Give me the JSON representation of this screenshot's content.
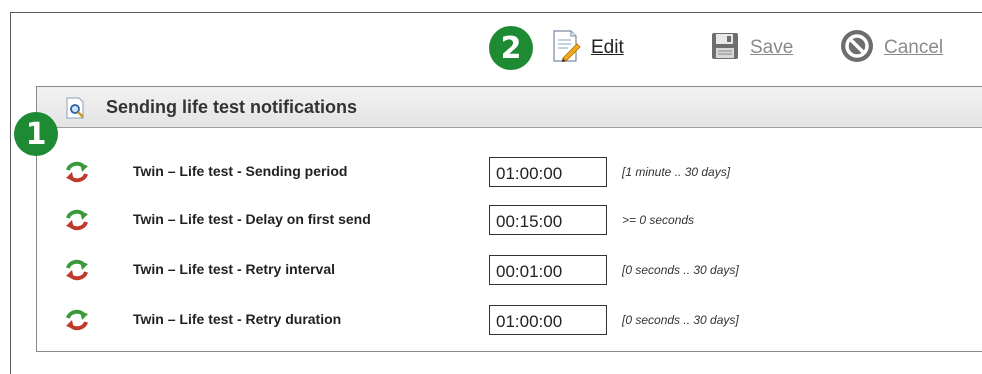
{
  "toolbar": {
    "badge": "2",
    "edit_label": "Edit",
    "save_label": "Save",
    "cancel_label": "Cancel"
  },
  "panel": {
    "badge": "1",
    "title": "Sending life test notifications",
    "rows": [
      {
        "label": "Twin – Life test - Sending period",
        "value": "01:00:00",
        "range": "[1 minute .. 30 days]"
      },
      {
        "label": "Twin – Life test - Delay on first send",
        "value": "00:15:00",
        "range": ">= 0 seconds"
      },
      {
        "label": "Twin – Life test - Retry interval",
        "value": "00:01:00",
        "range": "[0 seconds .. 30 days]"
      },
      {
        "label": "Twin – Life test - Retry duration",
        "value": "01:00:00",
        "range": "[0 seconds .. 30 days]"
      }
    ]
  },
  "icons": {
    "edit": "document-pencil-icon",
    "save": "floppy-disk-icon",
    "cancel": "no-entry-icon",
    "header": "document-magnifier-icon",
    "row": "refresh-arrows-icon"
  },
  "colors": {
    "badge": "#1e8a33",
    "disabled_text": "#8a8a8a"
  }
}
